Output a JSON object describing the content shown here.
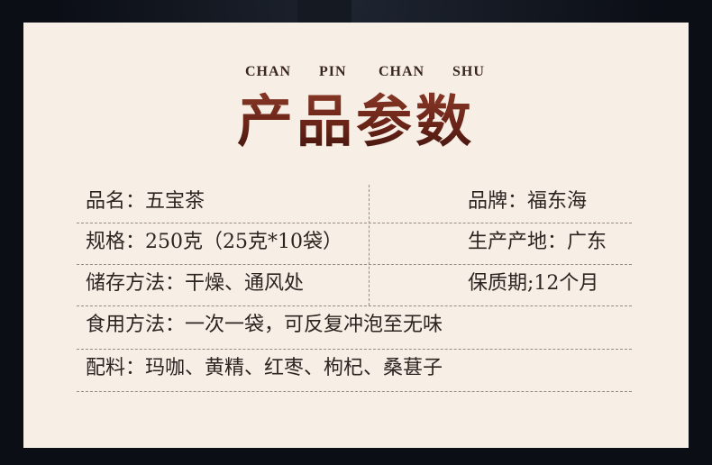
{
  "header": {
    "pinyin": [
      "CHAN",
      "PIN",
      "CHAN",
      "SHU"
    ],
    "title": "产品参数"
  },
  "rows": [
    {
      "left": "品名：五宝茶",
      "right": "品牌：福东海"
    },
    {
      "left": "规格：250克（25克*10袋）",
      "right": "生产产地：广东"
    },
    {
      "left": "储存方法：干燥、通风处",
      "right": "保质期;12个月"
    },
    {
      "full": "食用方法：一次一袋，可反复冲泡至无味"
    },
    {
      "full": "配料：玛咖、黄精、红枣、枸杞、桑葚子"
    }
  ],
  "colors": {
    "title": "#6b2a20",
    "card": "#f7efe6",
    "text": "#2c2420",
    "background": "#0e121b"
  }
}
